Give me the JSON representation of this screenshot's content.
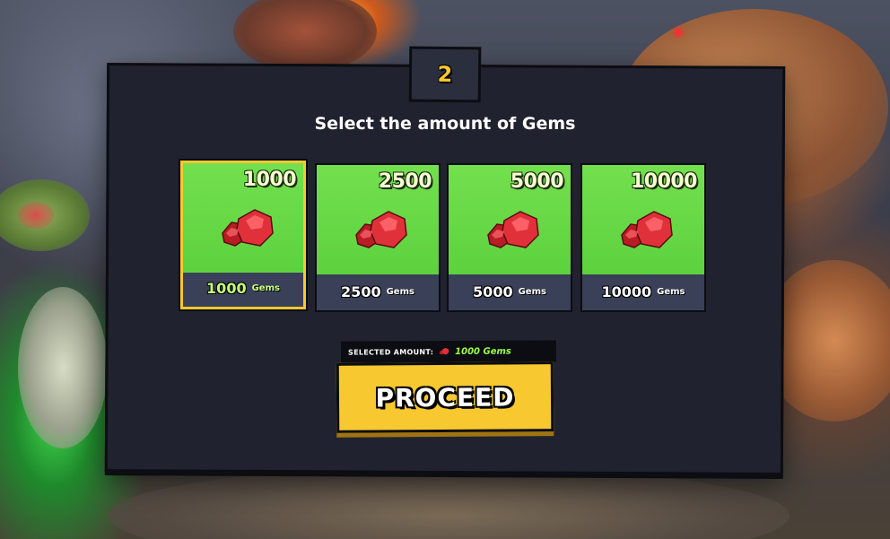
{
  "step": {
    "number": "2"
  },
  "title": "Select the amount of Gems",
  "options": [
    {
      "amount": "1000",
      "label_number": "1000",
      "unit": "Gems",
      "selected": true
    },
    {
      "amount": "2500",
      "label_number": "2500",
      "unit": "Gems",
      "selected": false
    },
    {
      "amount": "5000",
      "label_number": "5000",
      "unit": "Gems",
      "selected": false
    },
    {
      "amount": "10000",
      "label_number": "10000",
      "unit": "Gems",
      "selected": false
    }
  ],
  "selection": {
    "label": "SELECTED AMOUNT:",
    "value": "1000 Gems",
    "icon": "gem-icon"
  },
  "proceed_label": "PROCEED",
  "colors": {
    "accent": "#f7c830",
    "card_green": "#5dd13e",
    "panel": "#20232f",
    "gem": "#d8262e",
    "selected_text": "#9cff4a"
  }
}
